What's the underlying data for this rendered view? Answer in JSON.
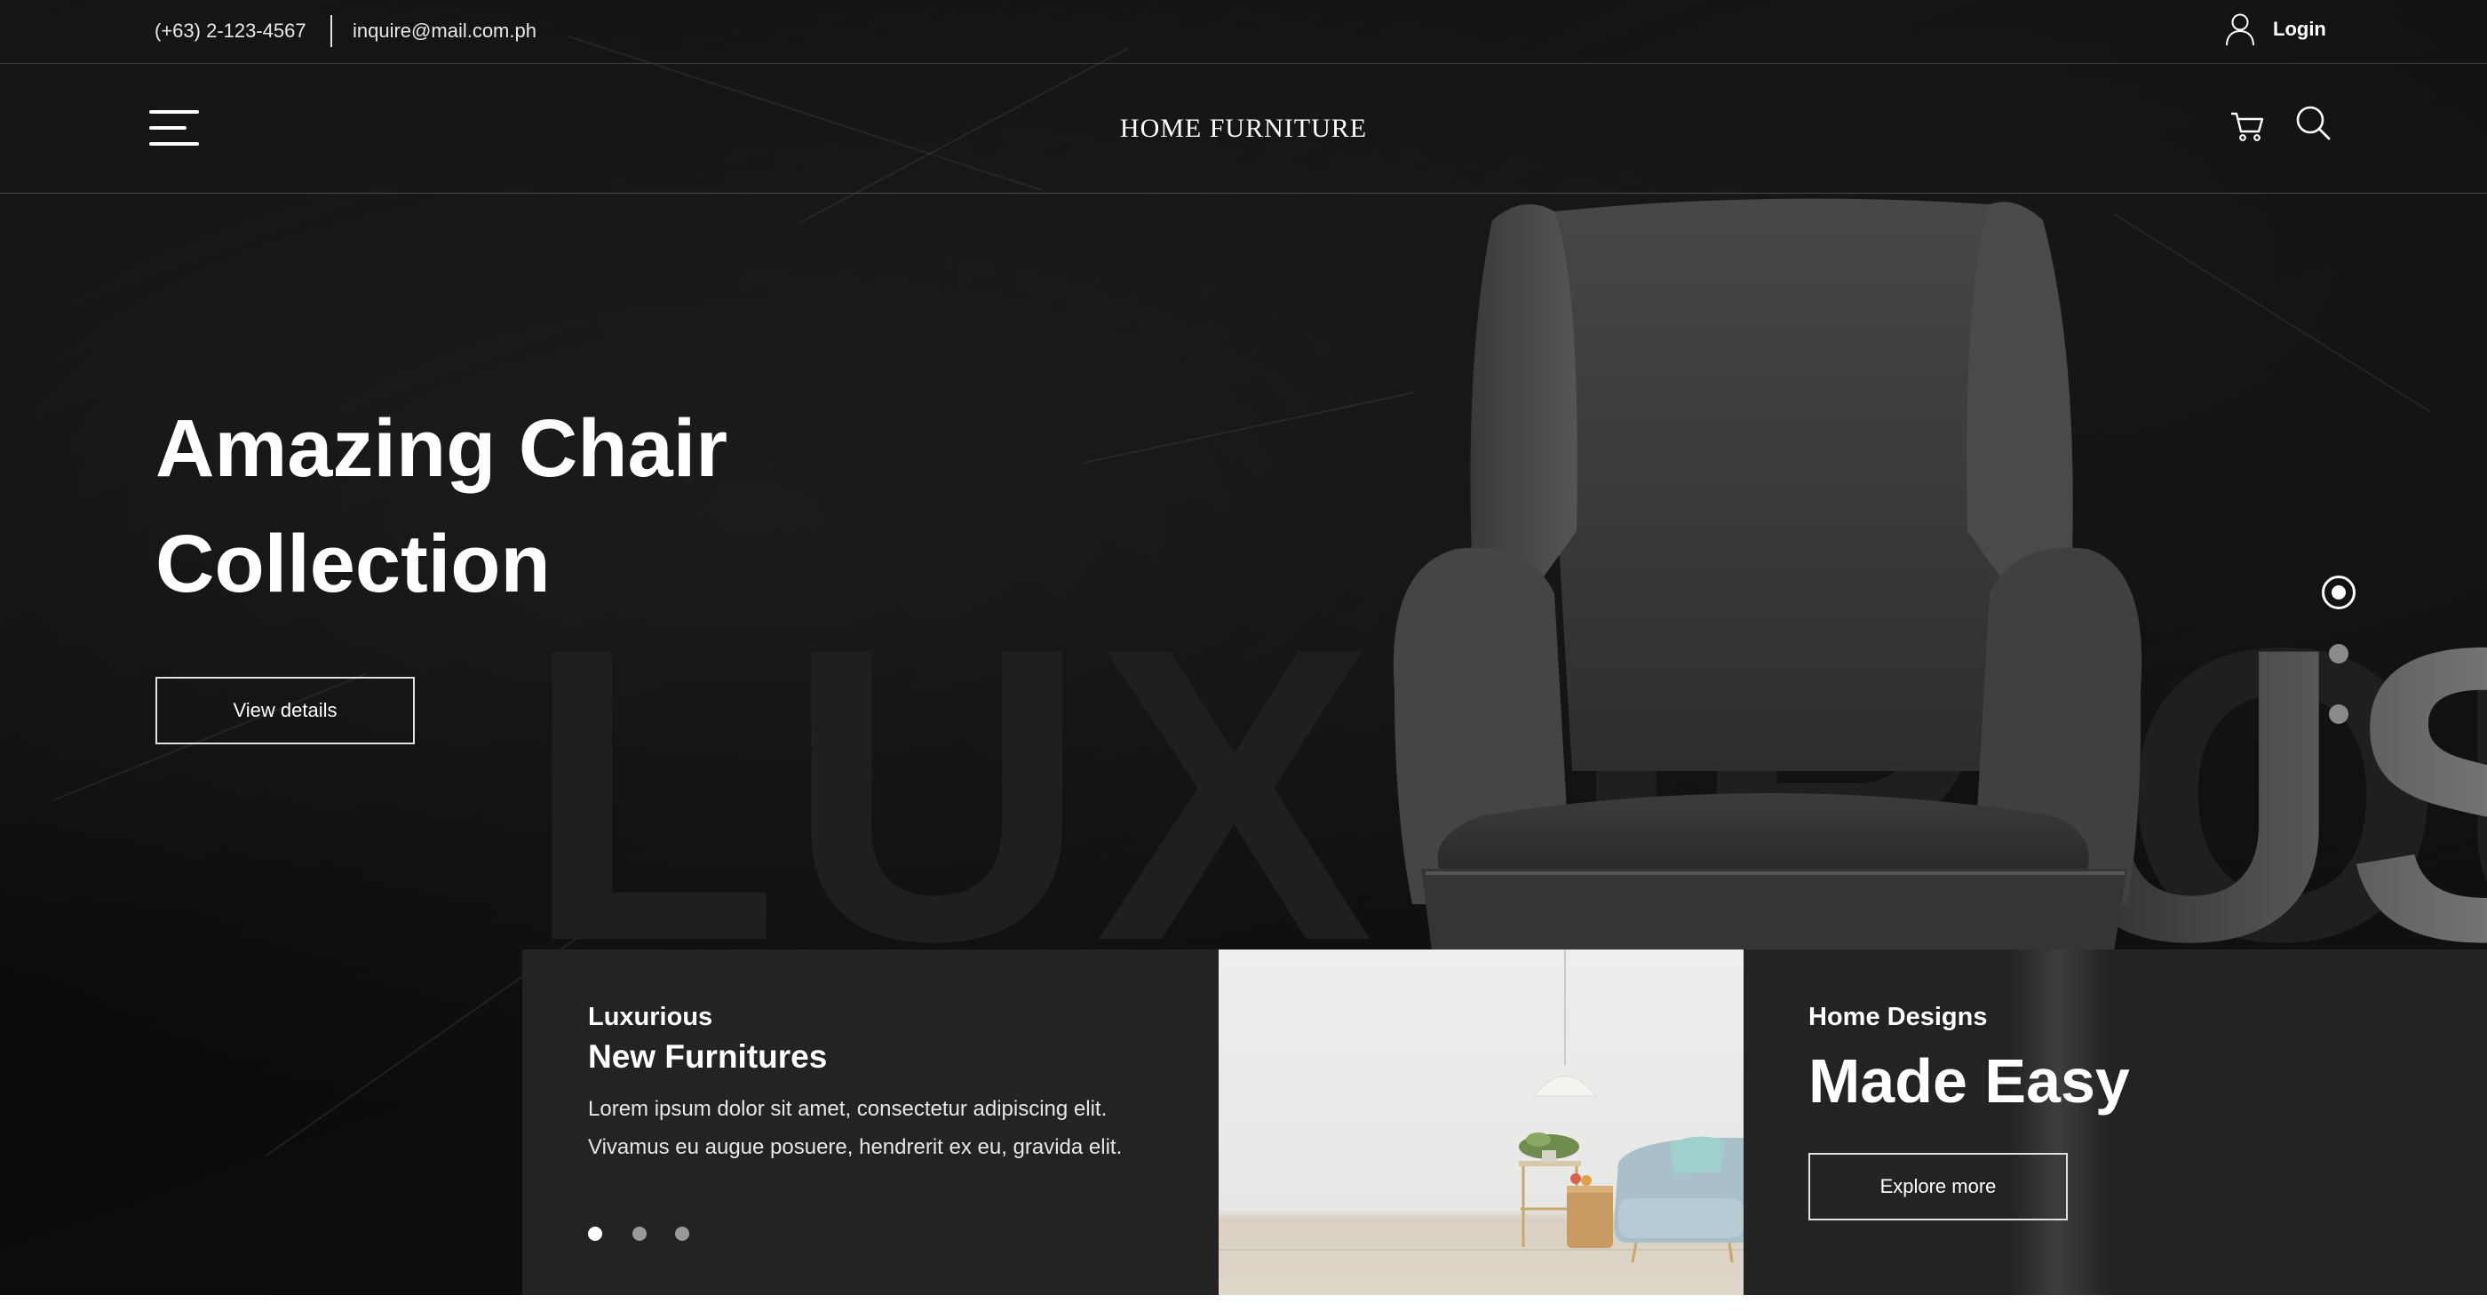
{
  "topbar": {
    "phone": "(+63) 2-123-4567",
    "email": "inquire@mail.com.ph",
    "login_label": "Login",
    "user_icon": "user-icon"
  },
  "navbar": {
    "brand": "HOME FURNITURE",
    "menu_icon": "hamburger-menu-icon",
    "cart_icon": "cart-icon",
    "search_icon": "search-icon"
  },
  "hero": {
    "title_line1": "Amazing Chair",
    "title_line2": "Collection",
    "cta_label": "View details",
    "background_word": "LUXURIOUS",
    "slide_indicators": {
      "count": 3,
      "active_index": 0
    }
  },
  "cards": {
    "left": {
      "kicker": "Luxurious",
      "title": "New Furnitures",
      "body": "Lorem ipsum dolor sit amet, consectetur adipiscing elit. Vivamus eu augue posuere, hendrerit ex eu, gravida elit.",
      "pagination": {
        "count": 3,
        "active_index": 0
      }
    },
    "right": {
      "kicker": "Home Designs",
      "title": "Made Easy",
      "cta_label": "Explore more"
    }
  },
  "colors": {
    "background": "#0e0e0e",
    "card": "#232323",
    "text": "#ffffff",
    "chair": "#4a4a4a"
  }
}
